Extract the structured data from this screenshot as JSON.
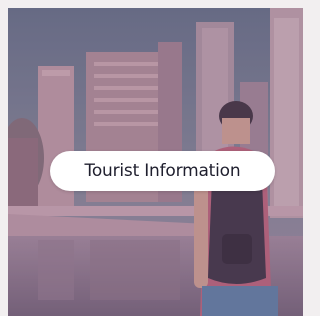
{
  "card": {
    "button_label": "Tourist Information",
    "photo": "city-skyline-traveler-photo"
  },
  "colors": {
    "overlay": "#8a6a8c",
    "sky": "#6f7f93",
    "button_bg": "#ffffff",
    "button_text": "#1f1f2e"
  }
}
